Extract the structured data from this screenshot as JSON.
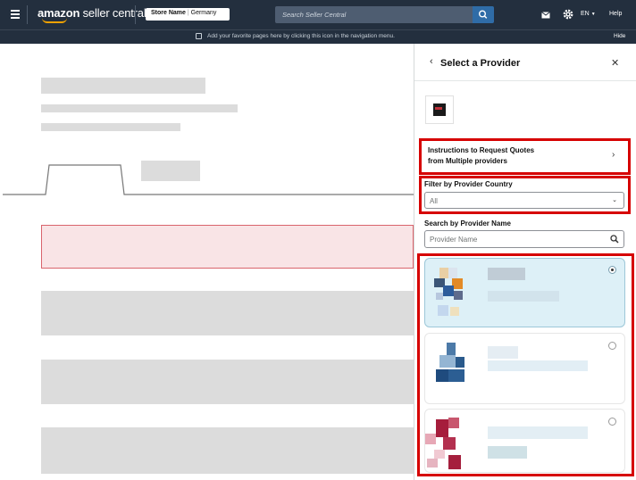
{
  "header": {
    "brand": "amazon",
    "brand_suffix": "seller central",
    "store_name": "Store Name",
    "store_country": "Germany",
    "search_placeholder": "Search Seller Central",
    "language": "EN",
    "help": "Help"
  },
  "favorites_bar": {
    "message": "Add your favorite pages here by clicking this icon in the navigation menu.",
    "hide": "Hide"
  },
  "panel": {
    "title": "Select a Provider",
    "instructions_line1": "Instructions to Request Quotes",
    "instructions_line2": "from Multiple providers",
    "filter_label": "Filter by Provider Country",
    "filter_value": "All",
    "search_label": "Search by Provider Name",
    "search_placeholder": "Provider Name"
  },
  "colors": {
    "nav_bg": "#232f3e",
    "search_btn": "#2f6ca7",
    "highlight_red": "#d60000",
    "selected_card_bg": "#ddf0f7",
    "placeholder_gray": "#dcdcdc"
  },
  "icons": [
    "menu-icon",
    "search-icon",
    "mail-icon",
    "gear-icon",
    "chevron-down-icon",
    "back-icon",
    "close-icon",
    "chevron-right-icon"
  ]
}
